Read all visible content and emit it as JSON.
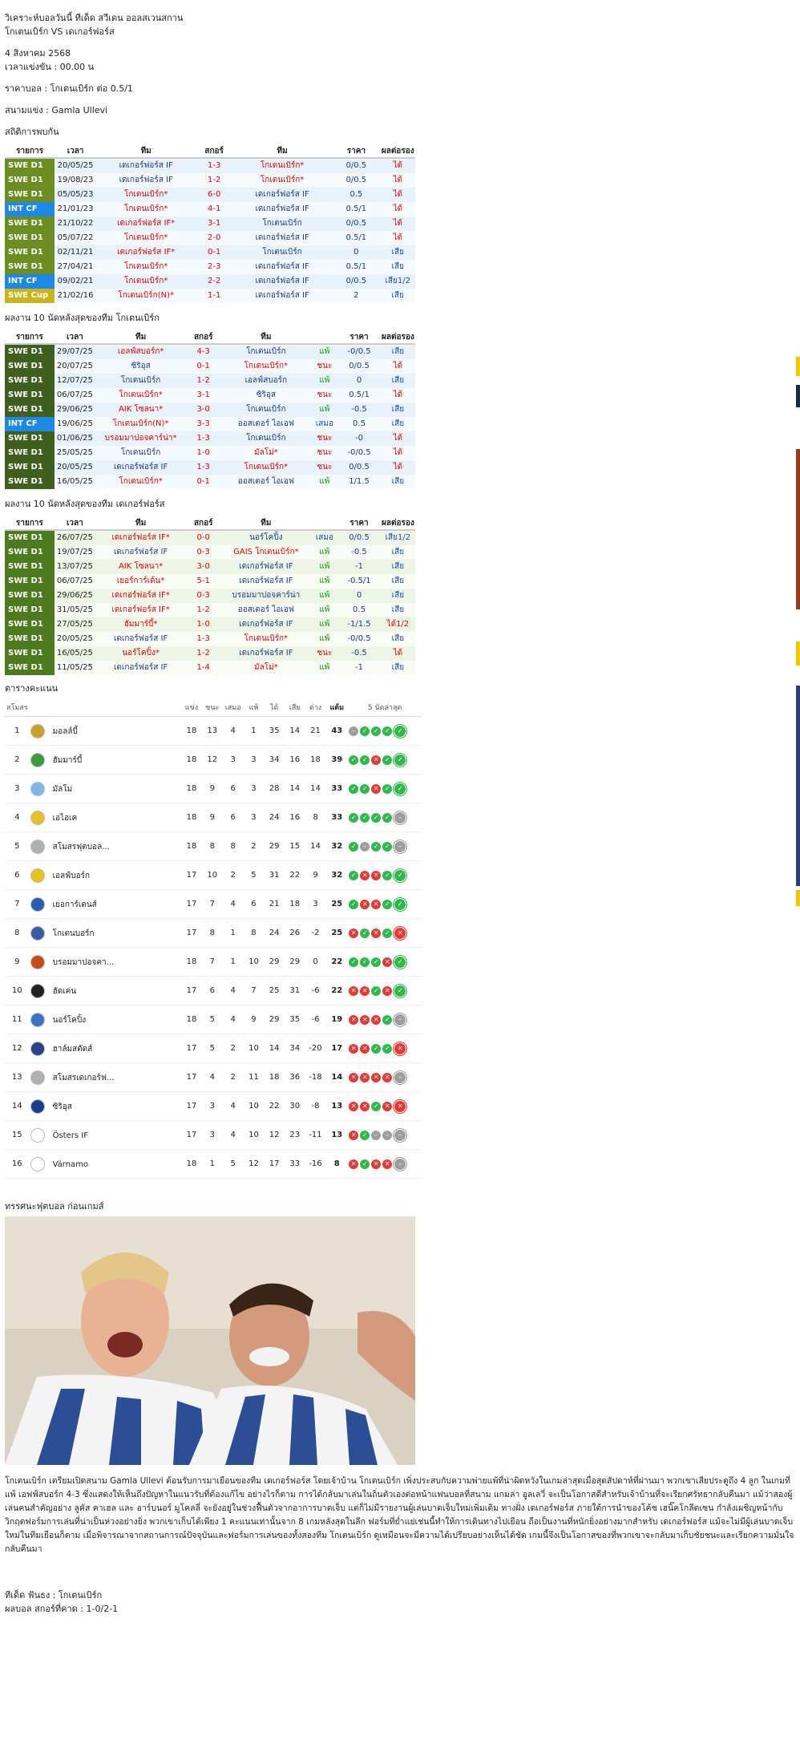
{
  "header": {
    "title_line1": "วิเคราะห์บอลวันนี้ ทีเด็ด สวีเดน ออลสเวนสกาน",
    "title_line2": "โกเตนเบิร์ก VS เดเกอร์ฟอร์ส",
    "date": "4 สิงหาคม 2568",
    "kickoff": "เวลาแข่งขัน : 00.00 น",
    "odds": "ราคาบอล : โกเตนเบิร์ก ต่อ 0.5/1",
    "venue": "สนามแข่ง : Gamla Ullevi",
    "h2h_title": "สถิติการพบกัน"
  },
  "cols": {
    "league": "รายการ",
    "time": "เวลา",
    "team": "ทีม",
    "score": "สกอร์",
    "team2": "ทีม",
    "price": "ราคา",
    "result": "ผลต่อรอง"
  },
  "h2h": [
    {
      "lg": "SWE D1",
      "date": "20/05/25",
      "home": "เดเกอร์ฟอร์ส IF",
      "score": "1-3",
      "away": "โกเตนเบิร์ก*",
      "price": "0/0.5",
      "res": "ได้"
    },
    {
      "lg": "SWE D1",
      "date": "19/08/23",
      "home": "เดเกอร์ฟอร์ส IF",
      "score": "1-2",
      "away": "โกเตนเบิร์ก*",
      "price": "0/0.5",
      "res": "ได้"
    },
    {
      "lg": "SWE D1",
      "date": "05/05/23",
      "home": "โกเตนเบิร์ก*",
      "score": "6-0",
      "away": "เดเกอร์ฟอร์ส IF",
      "price": "0.5",
      "res": "ได้"
    },
    {
      "lg": "INT CF",
      "date": "21/01/23",
      "home": "โกเตนเบิร์ก*",
      "score": "4-1",
      "away": "เดเกอร์ฟอร์ส IF",
      "price": "0.5/1",
      "res": "ได้"
    },
    {
      "lg": "SWE D1",
      "date": "21/10/22",
      "home": "เดเกอร์ฟอร์ส IF*",
      "score": "3-1",
      "away": "โกเตนเบิร์ก",
      "price": "0/0.5",
      "res": "ได้"
    },
    {
      "lg": "SWE D1",
      "date": "05/07/22",
      "home": "โกเตนเบิร์ก*",
      "score": "2-0",
      "away": "เดเกอร์ฟอร์ส IF",
      "price": "0.5/1",
      "res": "ได้"
    },
    {
      "lg": "SWE D1",
      "date": "02/11/21",
      "home": "เดเกอร์ฟอร์ส IF*",
      "score": "0-1",
      "away": "โกเตนเบิร์ก",
      "price": "0",
      "res": "เสีย"
    },
    {
      "lg": "SWE D1",
      "date": "27/04/21",
      "home": "โกเตนเบิร์ก*",
      "score": "2-3",
      "away": "เดเกอร์ฟอร์ส IF",
      "price": "0.5/1",
      "res": "เสีย"
    },
    {
      "lg": "INT CF",
      "date": "09/02/21",
      "home": "โกเตนเบิร์ก*",
      "score": "2-2",
      "away": "เดเกอร์ฟอร์ส IF",
      "price": "0/0.5",
      "res": "เสีย1/2"
    },
    {
      "lg": "SWE Cup",
      "date": "21/02/16",
      "home": "โกเตนเบิร์ก(N)*",
      "score": "1-1",
      "away": "เดเกอร์ฟอร์ส IF",
      "price": "2",
      "res": "เสีย"
    }
  ],
  "form1_title": "ผลงาน 10 นัดหลังสุดของทีม โกเตนเบิร์ก",
  "form1": [
    {
      "lg": "SWE D1",
      "date": "29/07/25",
      "home": "เอลฟ์สบอร์ก*",
      "score": "4-3",
      "away": "โกเตนเบิร์ก",
      "wl": "แพ้",
      "price": "-0/0.5",
      "res": "เสีย"
    },
    {
      "lg": "SWE D1",
      "date": "20/07/25",
      "home": "ซิริอุส",
      "score": "0-1",
      "away": "โกเตนเบิร์ก*",
      "wl": "ชนะ",
      "price": "0/0.5",
      "res": "ได้"
    },
    {
      "lg": "SWE D1",
      "date": "12/07/25",
      "home": "โกเตนเบิร์ก",
      "score": "1-2",
      "away": "เอลฟ์สบอร์ก",
      "wl": "แพ้",
      "price": "0",
      "res": "เสีย"
    },
    {
      "lg": "SWE D1",
      "date": "06/07/25",
      "home": "โกเตนเบิร์ก*",
      "score": "3-1",
      "away": "ซิริอุส",
      "wl": "ชนะ",
      "price": "0.5/1",
      "res": "ได้"
    },
    {
      "lg": "SWE D1",
      "date": "29/06/25",
      "home": "AIK โซลนา*",
      "score": "3-0",
      "away": "โกเตนเบิร์ก",
      "wl": "แพ้",
      "price": "-0.5",
      "res": "เสีย"
    },
    {
      "lg": "INT CF",
      "date": "19/06/25",
      "home": "โกเตนเบิร์ก(N)*",
      "score": "3-3",
      "away": "ออสเตอร์ ไอเอฟ",
      "wl": "เสมอ",
      "price": "0.5",
      "res": "เสีย"
    },
    {
      "lg": "SWE D1",
      "date": "01/06/25",
      "home": "บรอมมาปอจคาร์น่า*",
      "score": "1-3",
      "away": "โกเตนเบิร์ก",
      "wl": "ชนะ",
      "price": "-0",
      "res": "ได้"
    },
    {
      "lg": "SWE D1",
      "date": "25/05/25",
      "home": "โกเตนเบิร์ก",
      "score": "1-0",
      "away": "มัลโม่*",
      "wl": "ชนะ",
      "price": "-0/0.5",
      "res": "ได้"
    },
    {
      "lg": "SWE D1",
      "date": "20/05/25",
      "home": "เดเกอร์ฟอร์ส IF",
      "score": "1-3",
      "away": "โกเตนเบิร์ก*",
      "wl": "ชนะ",
      "price": "0/0.5",
      "res": "ได้"
    },
    {
      "lg": "SWE D1",
      "date": "16/05/25",
      "home": "โกเตนเบิร์ก*",
      "score": "0-1",
      "away": "ออสเตอร์ ไอเอฟ",
      "wl": "แพ้",
      "price": "1/1.5",
      "res": "เสีย"
    }
  ],
  "form2_title": "ผลงาน 10 นัดหลังสุดของทีม เดเกอร์ฟอร์ส",
  "form2": [
    {
      "lg": "SWE D1",
      "date": "26/07/25",
      "home": "เดเกอร์ฟอร์ส IF*",
      "score": "0-0",
      "away": "นอร์โคปิ้ง",
      "wl": "เสมอ",
      "price": "0/0.5",
      "res": "เสีย1/2"
    },
    {
      "lg": "SWE D1",
      "date": "19/07/25",
      "home": "เดเกอร์ฟอร์ส IF",
      "score": "0-3",
      "away": "GAIS โกเตนเบิร์ก*",
      "wl": "แพ้",
      "price": "-0.5",
      "res": "เสีย"
    },
    {
      "lg": "SWE D1",
      "date": "13/07/25",
      "home": "AIK โซลนา*",
      "score": "3-0",
      "away": "เดเกอร์ฟอร์ส IF",
      "wl": "แพ้",
      "price": "-1",
      "res": "เสีย"
    },
    {
      "lg": "SWE D1",
      "date": "06/07/25",
      "home": "เยอร์การ์เด้น*",
      "score": "5-1",
      "away": "เดเกอร์ฟอร์ส IF",
      "wl": "แพ้",
      "price": "-0.5/1",
      "res": "เสีย"
    },
    {
      "lg": "SWE D1",
      "date": "29/06/25",
      "home": "เดเกอร์ฟอร์ส IF*",
      "score": "0-3",
      "away": "บรอมมาปอจคาร์น่า",
      "wl": "แพ้",
      "price": "0",
      "res": "เสีย"
    },
    {
      "lg": "SWE D1",
      "date": "31/05/25",
      "home": "เดเกอร์ฟอร์ส IF*",
      "score": "1-2",
      "away": "ออสเตอร์ ไอเอฟ",
      "wl": "แพ้",
      "price": "0.5",
      "res": "เสีย"
    },
    {
      "lg": "SWE D1",
      "date": "27/05/25",
      "home": "ฮัมมาร์บี้*",
      "score": "1-0",
      "away": "เดเกอร์ฟอร์ส IF",
      "wl": "แพ้",
      "price": "-1/1.5",
      "res": "ได้1/2"
    },
    {
      "lg": "SWE D1",
      "date": "20/05/25",
      "home": "เดเกอร์ฟอร์ส IF",
      "score": "1-3",
      "away": "โกเตนเบิร์ก*",
      "wl": "แพ้",
      "price": "-0/0.5",
      "res": "เสีย"
    },
    {
      "lg": "SWE D1",
      "date": "16/05/25",
      "home": "นอร์โคปิ้ง*",
      "score": "1-2",
      "away": "เดเกอร์ฟอร์ส IF",
      "wl": "ชนะ",
      "price": "-0.5",
      "res": "ได้"
    },
    {
      "lg": "SWE D1",
      "date": "11/05/25",
      "home": "เดเกอร์ฟอร์ส IF",
      "score": "1-4",
      "away": "มัลโม่*",
      "wl": "แพ้",
      "price": "-1",
      "res": "เสีย"
    }
  ],
  "standings_title": "ตารางคะแนน",
  "st_cols": {
    "club": "สโมสร",
    "p": "แข่ง",
    "w": "ชนะ",
    "d": "เสมอ",
    "l": "แพ้",
    "gf": "ได้",
    "ga": "เสีย",
    "gd": "ต่าง",
    "pts": "แต้ม",
    "last5": "5 นัดล่าสุด"
  },
  "standings": [
    {
      "pos": "1",
      "name": "มอลล์บี้",
      "p": "18",
      "w": "13",
      "d": "4",
      "l": "1",
      "gf": "35",
      "ga": "14",
      "gd": "21",
      "pts": "43",
      "form": "dwwww",
      "logo": "#c9a227"
    },
    {
      "pos": "2",
      "name": "ฮัมมาร์บี้",
      "p": "18",
      "w": "12",
      "d": "3",
      "l": "3",
      "gf": "34",
      "ga": "16",
      "gd": "18",
      "pts": "39",
      "form": "wwlww",
      "logo": "#3c9a3c"
    },
    {
      "pos": "3",
      "name": "มัลโม่",
      "p": "18",
      "w": "9",
      "d": "6",
      "l": "3",
      "gf": "28",
      "ga": "14",
      "gd": "14",
      "pts": "33",
      "form": "wwlww",
      "logo": "#7fb6e6"
    },
    {
      "pos": "4",
      "name": "เอไอเค",
      "p": "18",
      "w": "9",
      "d": "6",
      "l": "3",
      "gf": "24",
      "ga": "16",
      "gd": "8",
      "pts": "33",
      "form": "wwwwd",
      "logo": "#e7c02b"
    },
    {
      "pos": "5",
      "name": "สโมสรฟุตบอล...",
      "p": "18",
      "w": "8",
      "d": "8",
      "l": "2",
      "gf": "29",
      "ga": "15",
      "gd": "14",
      "pts": "32",
      "form": "wdwwd",
      "logo": "#b0b0b0"
    },
    {
      "pos": "6",
      "name": "เอลฟ์บอร์ก",
      "p": "17",
      "w": "10",
      "d": "2",
      "l": "5",
      "gf": "31",
      "ga": "22",
      "gd": "9",
      "pts": "32",
      "form": "wllww",
      "logo": "#e6c21a"
    },
    {
      "pos": "7",
      "name": "เยอการ์เดนส์",
      "p": "17",
      "w": "7",
      "d": "4",
      "l": "6",
      "gf": "21",
      "ga": "18",
      "gd": "3",
      "pts": "25",
      "form": "wllww",
      "logo": "#2a5db0"
    },
    {
      "pos": "8",
      "name": "โกเตนบอร์ก",
      "p": "17",
      "w": "8",
      "d": "1",
      "l": "8",
      "gf": "24",
      "ga": "26",
      "gd": "-2",
      "pts": "25",
      "form": "lwlwl",
      "logo": "#3a5ca6"
    },
    {
      "pos": "9",
      "name": "บรอมมาปอจคา...",
      "p": "18",
      "w": "7",
      "d": "1",
      "l": "10",
      "gf": "29",
      "ga": "29",
      "gd": "0",
      "pts": "22",
      "form": "wwwlw",
      "logo": "#c74b1a"
    },
    {
      "pos": "10",
      "name": "ฮัดเค่น",
      "p": "17",
      "w": "6",
      "d": "4",
      "l": "7",
      "gf": "25",
      "ga": "31",
      "gd": "-6",
      "pts": "22",
      "form": "llwlw",
      "logo": "#222222"
    },
    {
      "pos": "11",
      "name": "นอร์โคปิ้ง",
      "p": "18",
      "w": "5",
      "d": "4",
      "l": "9",
      "gf": "29",
      "ga": "35",
      "gd": "-6",
      "pts": "19",
      "form": "lllwd",
      "logo": "#3a74c2"
    },
    {
      "pos": "12",
      "name": "ฮาล์มสตัดส์",
      "p": "17",
      "w": "5",
      "d": "2",
      "l": "10",
      "gf": "14",
      "ga": "34",
      "gd": "-20",
      "pts": "17",
      "form": "llwwl",
      "logo": "#2b3f8a"
    },
    {
      "pos": "13",
      "name": "สโมสรเดเกอร์ฟ...",
      "p": "17",
      "w": "4",
      "d": "2",
      "l": "11",
      "gf": "18",
      "ga": "36",
      "gd": "-18",
      "pts": "14",
      "form": "lllld",
      "logo": "#b0b0b0"
    },
    {
      "pos": "14",
      "name": "ซิริอุส",
      "p": "17",
      "w": "3",
      "d": "4",
      "l": "10",
      "gf": "22",
      "ga": "30",
      "gd": "-8",
      "pts": "13",
      "form": "llwll",
      "logo": "#1d3c8a"
    },
    {
      "pos": "15",
      "name": "Östers IF",
      "p": "17",
      "w": "3",
      "d": "4",
      "l": "10",
      "gf": "12",
      "ga": "23",
      "gd": "-11",
      "pts": "13",
      "form": "lwddd",
      "logo": "#ffffff"
    },
    {
      "pos": "16",
      "name": "Värnamo",
      "p": "18",
      "w": "1",
      "d": "5",
      "l": "12",
      "gf": "17",
      "ga": "33",
      "gd": "-16",
      "pts": "8",
      "form": "lwlld",
      "logo": "#ffffff"
    }
  ],
  "preview_title": "ทรรศนะฟุตบอล ก่อนเกมส์",
  "analysis": "โกเตนเบิร์ก เตรียมเปิดสนาม Gamla Ullevi ต้อนรับการมาเยือนของทีม เดเกอร์ฟอร์ส โดยเจ้าบ้าน โกเตนเบิร์ก เพิ่งประสบกับความพ่ายแพ้ที่น่าผิดหวังในเกมล่าสุดเมื่อสุดสัปดาห์ที่ผ่านมา พวกเขาเสียประตูถึง 4 ลูก ในเกมที่แพ้ เอฟฟ์สบอร์ก 4-3 ซึ่งแสดงให้เห็นถึงปัญหาในแนวรับที่ต้องแก้ไข อย่างไรก็ตาม การได้กลับมาเล่นในถิ่นตัวเองต่อหน้าแฟนบอลที่สนาม แกมล่า อูลเลวี่ จะเป็นโอกาสดีสำหรับเจ้าบ้านที่จะเรียกศรัทธากลับคืนมา แม้ว่าสองผู้เล่นคนสำคัญอย่าง ลูคัส คาเฮล และ อาร์บนอร์ มูโคลลี่ จะยังอยู่ในช่วงฟื้นตัวจากอาการบาดเจ็บ แต่ก็ไม่มีรายงานผู้เล่นบาดเจ็บใหม่เพิ่มเติม ทางฝั่ง เดเกอร์ฟอร์ส ภายใต้การนำของโค้ช เฮนิ๊คโกลีดเซน กำลังเผชิญหน้ากับวิกฤตฟอร์มการเล่นที่น่าเป็นห่วงอย่างยิ่ง พวกเขาเก็บได้เพียง 1 คะแนนเท่านั้นจาก 8 เกมหลังสุดในลีก ฟอร์มที่ย่ำแย่เช่นนี้ทำให้การเดินทางไปเยือน ถือเป็นงานที่หนักยิ่งอย่างมากสำหรับ เดเกอร์ฟอร์ส แม้จะไม่มีผู้เล่นบาดเจ็บใหม่ในทีมเยือนก็ตาม เมื่อพิจารณาจากสถานการณ์ปัจจุบันและฟอร์มการเล่นของทั้งสองทีม โกเตนเบิร์ก ดูเหมือนจะมีความได้เปรียบอย่างเห็นได้ชัด เกมนี้จึงเป็นโอกาสของที่พวกเขาจะกลับมาเก็บชัยชนะและเรียกความมั่นใจกลับคืนมา",
  "tip": "ทีเด็ด ฟันธง : โกเตนเบิร์ก",
  "score_pred": "ผลบอล สกอร์ที่คาด : 1-0/2-1",
  "form_symbols": {
    "w": "✓",
    "l": "✕",
    "d": "–"
  }
}
